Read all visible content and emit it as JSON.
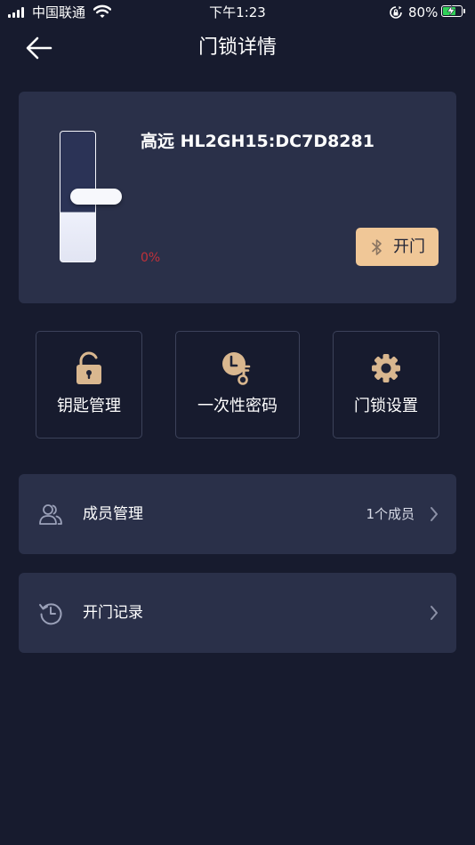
{
  "status_bar": {
    "carrier": "中国联通",
    "time": "下午1:23",
    "battery_percent": "80%",
    "battery_level": 0.8,
    "charging": true
  },
  "nav": {
    "title": "门锁详情",
    "back_icon": "arrow-left-icon"
  },
  "lock": {
    "name": "高远 HL2GH15:DC7D8281",
    "battery_text": "0%",
    "open_button_label": "开门",
    "open_button_icon": "bluetooth-icon",
    "accent_color": "#f0c797",
    "battery_color": "#c0313a"
  },
  "tiles": [
    {
      "label": "钥匙管理",
      "icon": "padlock-icon"
    },
    {
      "label": "一次性密码",
      "icon": "clock-key-icon"
    },
    {
      "label": "门锁设置",
      "icon": "gear-icon"
    }
  ],
  "rows": {
    "members": {
      "label": "成员管理",
      "value": "1个成员",
      "icon": "members-icon"
    },
    "records": {
      "label": "开门记录",
      "icon": "history-icon"
    }
  },
  "colors": {
    "background": "#171b2e",
    "card": "#2a3049",
    "icon_gold": "#d9b78f"
  }
}
